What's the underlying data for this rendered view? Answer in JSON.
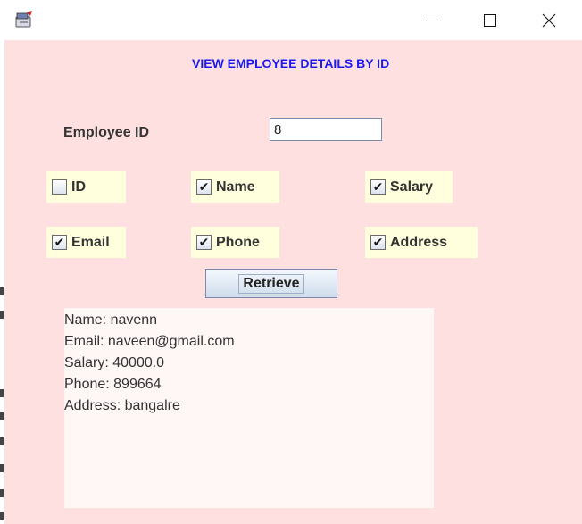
{
  "window": {
    "title": "",
    "icons": {
      "app": "java-cup-icon",
      "minimize": "minimize-icon",
      "maximize": "maximize-icon",
      "close": "close-icon"
    }
  },
  "form": {
    "heading": "VIEW EMPLOYEE DETAILS BY ID",
    "employee_id_label": "Employee ID",
    "employee_id_value": "8",
    "checkboxes": [
      {
        "label": "ID",
        "checked": false
      },
      {
        "label": "Name",
        "checked": true
      },
      {
        "label": "Salary",
        "checked": true
      },
      {
        "label": "Email",
        "checked": true
      },
      {
        "label": "Phone",
        "checked": true
      },
      {
        "label": "Address",
        "checked": true
      }
    ],
    "retrieve_label": "Retrieve"
  },
  "result": {
    "lines": [
      "Name: navenn",
      "Email: naveen@gmail.com",
      "Salary: 40000.0",
      "Phone: 899664",
      "Address: bangalre"
    ]
  },
  "colors": {
    "panel_bg": "#ffe0e0",
    "heading": "#1a1aee",
    "checkbox_bg": "#ffffdd",
    "result_bg": "#fff6f6"
  }
}
